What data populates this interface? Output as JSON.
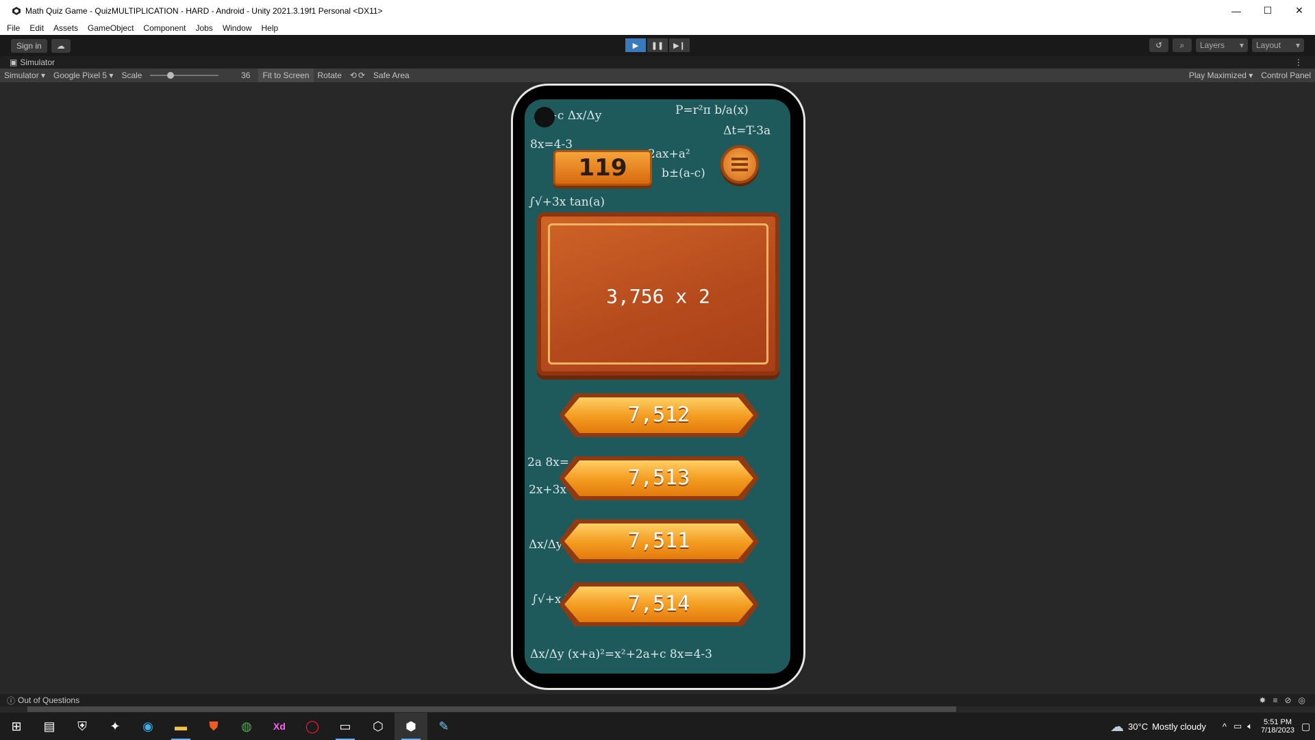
{
  "window": {
    "title": "Math Quiz Game - QuizMULTIPLICATION - HARD - Android - Unity 2021.3.19f1 Personal <DX11>",
    "controls": [
      "—",
      "☐",
      "✕"
    ]
  },
  "menu": [
    "File",
    "Edit",
    "Assets",
    "GameObject",
    "Component",
    "Jobs",
    "Window",
    "Help"
  ],
  "toolbar": {
    "sign_in": "Sign in",
    "layers": "Layers",
    "layout": "Layout"
  },
  "tab": {
    "label": "Simulator"
  },
  "simulator_bar": {
    "mode": "Simulator",
    "device": "Google Pixel 5",
    "scale_label": "Scale",
    "scale_value": "36",
    "fit": "Fit to Screen",
    "rotate": "Rotate",
    "safe_area": "Safe Area",
    "play_maximized": "Play Maximized",
    "control_panel": "Control Panel"
  },
  "game": {
    "score": "119",
    "question": "3,756 x 2",
    "answers": [
      "7,512",
      "7,513",
      "7,511",
      "7,514"
    ]
  },
  "status": {
    "message": "Out of Questions"
  },
  "taskbar": {
    "weather_temp": "30°C",
    "weather_text": "Mostly cloudy",
    "time": "5:51 PM",
    "date": "7/18/2023"
  },
  "colors": {
    "chalkboard": "#1e5a5c",
    "wood": "#b44a1c",
    "button": "#f39a1f",
    "play_active": "#3a79bb"
  }
}
